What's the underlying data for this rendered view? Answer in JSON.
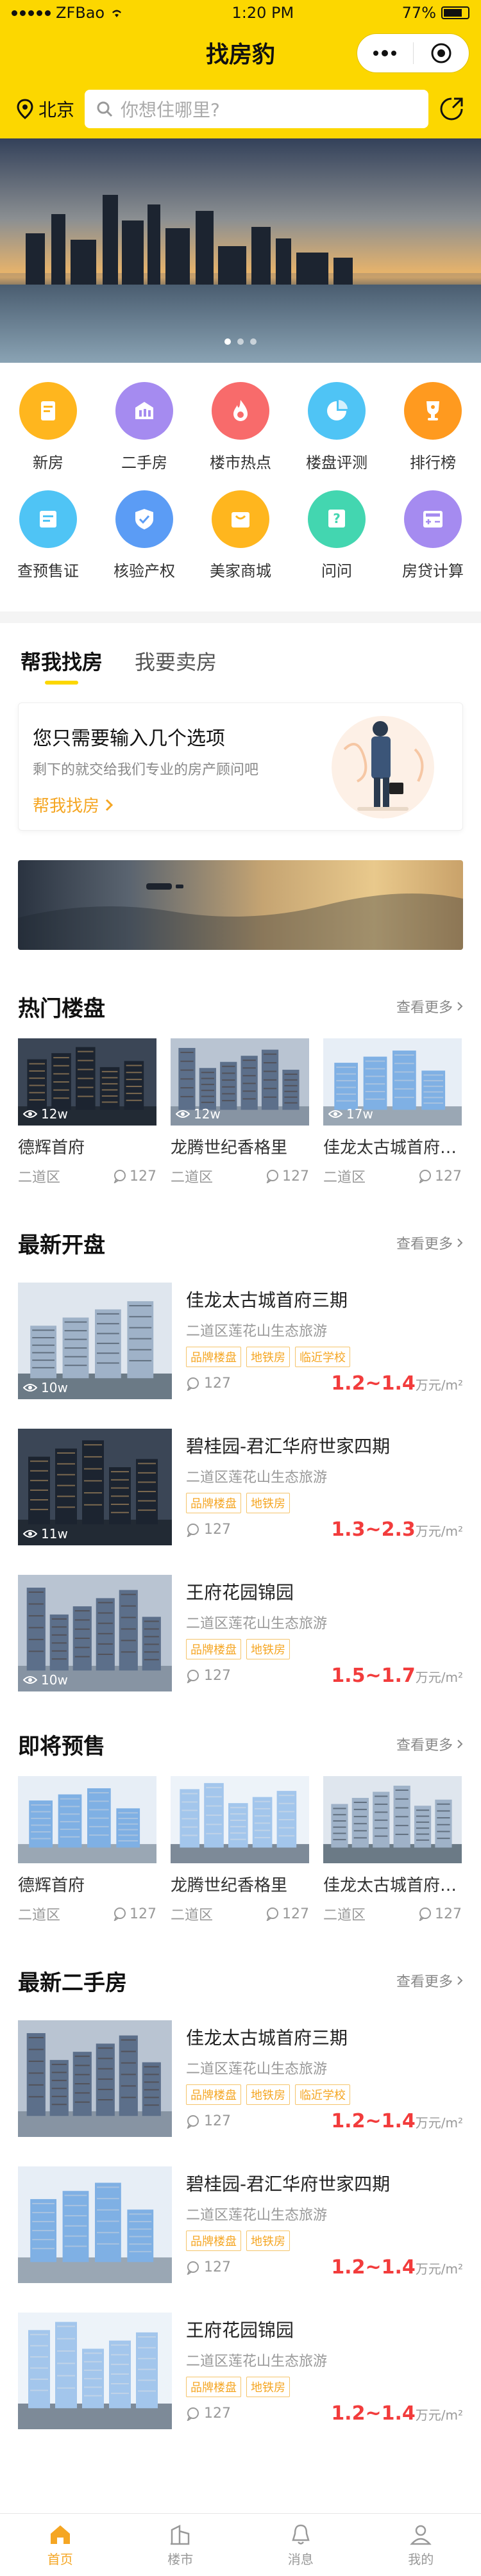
{
  "status": {
    "carrier": "ZFBao",
    "time": "1:20 PM",
    "battery": "77%"
  },
  "nav": {
    "title": "找房豹"
  },
  "search": {
    "city": "北京",
    "placeholder": "你想住哪里?"
  },
  "banner": {
    "pages": 3,
    "active": 1
  },
  "colors": {
    "brand": "#fcd700",
    "accent": "#f5a623",
    "price": "#f23c3c"
  },
  "grid": [
    [
      {
        "label": "新房",
        "color": "#ffb61e",
        "icon": "document-icon"
      },
      {
        "label": "二手房",
        "color": "#a58bf0",
        "icon": "building-icon"
      },
      {
        "label": "楼市热点",
        "color": "#f86b6b",
        "icon": "flame-icon"
      },
      {
        "label": "楼盘评测",
        "color": "#4fc4f5",
        "icon": "pie-icon"
      },
      {
        "label": "排行榜",
        "color": "#ff9a1f",
        "icon": "trophy-icon"
      }
    ],
    [
      {
        "label": "查预售证",
        "color": "#4fc4f5",
        "icon": "certificate-icon"
      },
      {
        "label": "核验产权",
        "color": "#5b9cf5",
        "icon": "shield-check-icon"
      },
      {
        "label": "美家商城",
        "color": "#ffb61e",
        "icon": "shopping-bag-icon"
      },
      {
        "label": "问问",
        "color": "#43d6b0",
        "icon": "question-icon"
      },
      {
        "label": "房贷计算",
        "color": "#a58bf0",
        "icon": "calculator-icon"
      }
    ]
  ],
  "tabs": [
    "帮我找房",
    "我要卖房"
  ],
  "help": {
    "title": "您只需要输入几个选项",
    "subtitle": "剩下的就交给我们专业的房产顾问吧",
    "link": "帮我找房"
  },
  "hot": {
    "title": "热门楼盘",
    "more": "查看更多",
    "items": [
      {
        "name": "德辉首府",
        "district": "二道区",
        "comments": "127",
        "views": "12w"
      },
      {
        "name": "龙腾世纪香格里",
        "district": "二道区",
        "comments": "127",
        "views": "12w"
      },
      {
        "name": "佳龙太古城首府三期",
        "district": "二道区",
        "comments": "127",
        "views": "17w"
      }
    ]
  },
  "newOpen": {
    "title": "最新开盘",
    "more": "查看更多",
    "items": [
      {
        "name": "佳龙太古城首府三期",
        "addr": "二道区莲花山生态旅游",
        "tags": [
          "品牌楼盘",
          "地铁房",
          "临近学校"
        ],
        "comments": "127",
        "price": "1.2~1.4",
        "unit": "万元/m²",
        "views": "10w"
      },
      {
        "name": "碧桂园-君汇华府世家四期",
        "addr": "二道区莲花山生态旅游",
        "tags": [
          "品牌楼盘",
          "地铁房"
        ],
        "comments": "127",
        "price": "1.3~2.3",
        "unit": "万元/m²",
        "views": "11w"
      },
      {
        "name": "王府花园锦园",
        "addr": "二道区莲花山生态旅游",
        "tags": [
          "品牌楼盘",
          "地铁房"
        ],
        "comments": "127",
        "price": "1.5~1.7",
        "unit": "万元/m²",
        "views": "10w"
      }
    ]
  },
  "presale": {
    "title": "即将预售",
    "more": "查看更多",
    "items": [
      {
        "name": "德辉首府",
        "district": "二道区",
        "comments": "127"
      },
      {
        "name": "龙腾世纪香格里",
        "district": "二道区",
        "comments": "127"
      },
      {
        "name": "佳龙太古城首府三期",
        "district": "二道区",
        "comments": "127"
      }
    ]
  },
  "second": {
    "title": "最新二手房",
    "more": "查看更多",
    "items": [
      {
        "name": "佳龙太古城首府三期",
        "addr": "二道区莲花山生态旅游",
        "tags": [
          "品牌楼盘",
          "地铁房",
          "临近学校"
        ],
        "comments": "127",
        "price": "1.2~1.4",
        "unit": "万元/m²"
      },
      {
        "name": "碧桂园-君汇华府世家四期",
        "addr": "二道区莲花山生态旅游",
        "tags": [
          "品牌楼盘",
          "地铁房"
        ],
        "comments": "127",
        "price": "1.2~1.4",
        "unit": "万元/m²"
      },
      {
        "name": "王府花园锦园",
        "addr": "二道区莲花山生态旅游",
        "tags": [
          "品牌楼盘",
          "地铁房"
        ],
        "comments": "127",
        "price": "1.2~1.4",
        "unit": "万元/m²"
      }
    ]
  },
  "tabbar": [
    {
      "label": "首页",
      "icon": "home-icon",
      "active": true
    },
    {
      "label": "楼市",
      "icon": "buildings-icon",
      "active": false
    },
    {
      "label": "消息",
      "icon": "bell-icon",
      "active": false
    },
    {
      "label": "我的",
      "icon": "user-icon",
      "active": false
    }
  ]
}
